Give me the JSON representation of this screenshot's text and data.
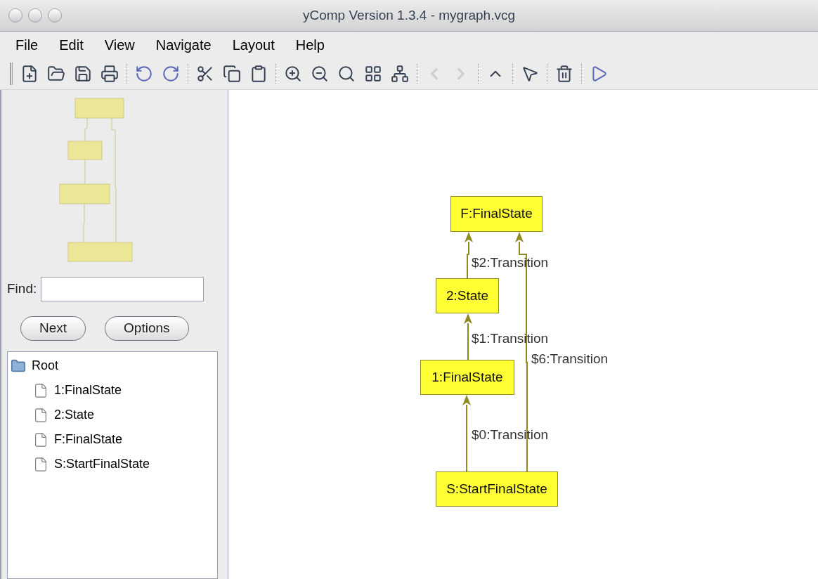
{
  "window": {
    "title": "yComp Version 1.3.4 - mygraph.vcg"
  },
  "menu": [
    "File",
    "Edit",
    "View",
    "Navigate",
    "Layout",
    "Help"
  ],
  "toolbar": [
    {
      "kind": "new",
      "disabled": false
    },
    {
      "kind": "open",
      "disabled": false
    },
    {
      "kind": "save",
      "disabled": false
    },
    {
      "kind": "print",
      "disabled": false
    },
    {
      "kind": "separator"
    },
    {
      "kind": "undo",
      "disabled": false
    },
    {
      "kind": "redo",
      "disabled": false
    },
    {
      "kind": "separator"
    },
    {
      "kind": "cut",
      "disabled": false
    },
    {
      "kind": "copy",
      "disabled": false
    },
    {
      "kind": "paste",
      "disabled": false
    },
    {
      "kind": "separator"
    },
    {
      "kind": "zoom-in",
      "disabled": false
    },
    {
      "kind": "zoom-out",
      "disabled": false
    },
    {
      "kind": "zoom-fit",
      "disabled": false
    },
    {
      "kind": "fit-graph",
      "disabled": false
    },
    {
      "kind": "layout",
      "disabled": false
    },
    {
      "kind": "separator"
    },
    {
      "kind": "back",
      "disabled": true
    },
    {
      "kind": "forward",
      "disabled": true
    },
    {
      "kind": "separator"
    },
    {
      "kind": "up",
      "disabled": false
    },
    {
      "kind": "separator"
    },
    {
      "kind": "select",
      "disabled": false
    },
    {
      "kind": "separator"
    },
    {
      "kind": "delete",
      "disabled": false
    },
    {
      "kind": "separator"
    },
    {
      "kind": "run",
      "disabled": false
    }
  ],
  "find": {
    "label": "Find:"
  },
  "buttons": [
    "Next",
    "Options"
  ],
  "tree": {
    "label": "Root",
    "expanded": true,
    "children": [
      {
        "label": "1:FinalState"
      },
      {
        "label": "2:State"
      },
      {
        "label": "F:FinalState"
      },
      {
        "label": "S:StartFinalState"
      }
    ]
  },
  "graph": {
    "nodes": [
      {
        "label": "F:FinalState"
      },
      {
        "label": "2:State"
      },
      {
        "label": "1:FinalState"
      },
      {
        "label": "S:StartFinalState"
      }
    ],
    "edges": [
      {
        "label": "$2:Transition"
      },
      {
        "label": "$1:Transition"
      },
      {
        "label": "$6:Transition"
      },
      {
        "label": "$0:Transition"
      }
    ]
  }
}
